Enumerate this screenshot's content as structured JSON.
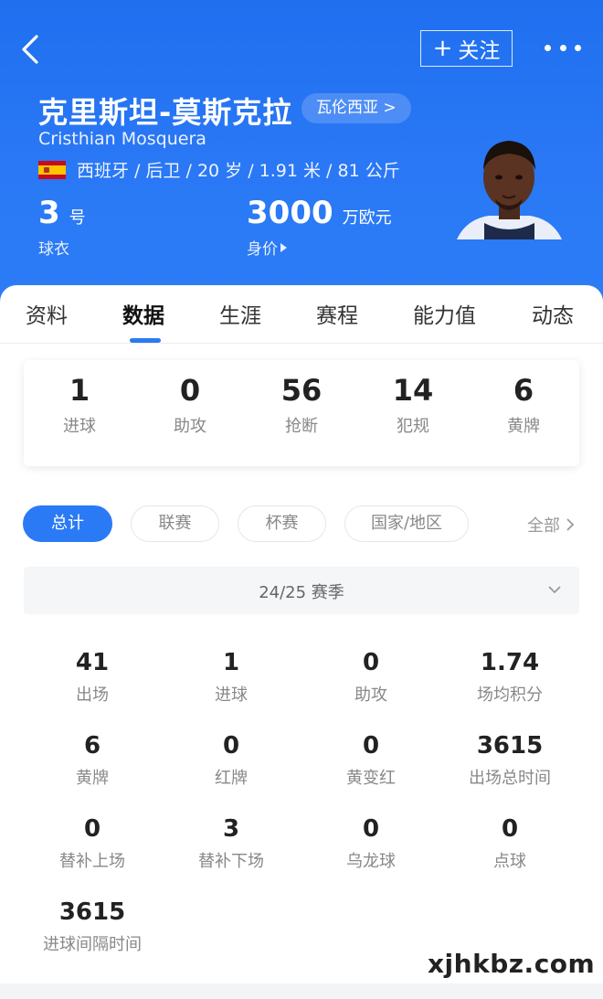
{
  "header": {
    "follow_label": "关注",
    "player_name_cn": "克里斯坦-莫斯克拉",
    "club_chip": "瓦伦西亚 >",
    "player_name_en": "Cristhian Mosquera",
    "meta": "西班牙 / 后卫 / 20 岁 / 1.91 米 / 81 公斤",
    "jersey_number": "3",
    "jersey_unit": "号",
    "jersey_label": "球衣",
    "market_value": "3000",
    "market_value_unit": "万欧元",
    "market_value_label": "身价",
    "flag_icon": "spain-flag-icon",
    "background_color": "#2a78f5"
  },
  "tabs": [
    "资料",
    "数据",
    "生涯",
    "赛程",
    "能力值",
    "动态"
  ],
  "active_tab": "数据",
  "summary": [
    {
      "value": "1",
      "label": "进球"
    },
    {
      "value": "0",
      "label": "助攻"
    },
    {
      "value": "56",
      "label": "抢断"
    },
    {
      "value": "14",
      "label": "犯规"
    },
    {
      "value": "6",
      "label": "黄牌"
    }
  ],
  "filters": [
    "总计",
    "联赛",
    "杯赛",
    "国家/地区"
  ],
  "active_filter": "总计",
  "all_link": "全部",
  "season": "24/25 赛季",
  "stats": [
    {
      "value": "41",
      "label": "出场"
    },
    {
      "value": "1",
      "label": "进球"
    },
    {
      "value": "0",
      "label": "助攻"
    },
    {
      "value": "1.74",
      "label": "场均积分"
    },
    {
      "value": "6",
      "label": "黄牌"
    },
    {
      "value": "0",
      "label": "红牌"
    },
    {
      "value": "0",
      "label": "黄变红"
    },
    {
      "value": "3615",
      "label": "出场总时间"
    },
    {
      "value": "0",
      "label": "替补上场"
    },
    {
      "value": "3",
      "label": "替补下场"
    },
    {
      "value": "0",
      "label": "乌龙球"
    },
    {
      "value": "0",
      "label": "点球"
    },
    {
      "value": "3615",
      "label": "进球间隔时间"
    }
  ],
  "watermark": "xjhkbz.com",
  "accent_color": "#2b7af5"
}
